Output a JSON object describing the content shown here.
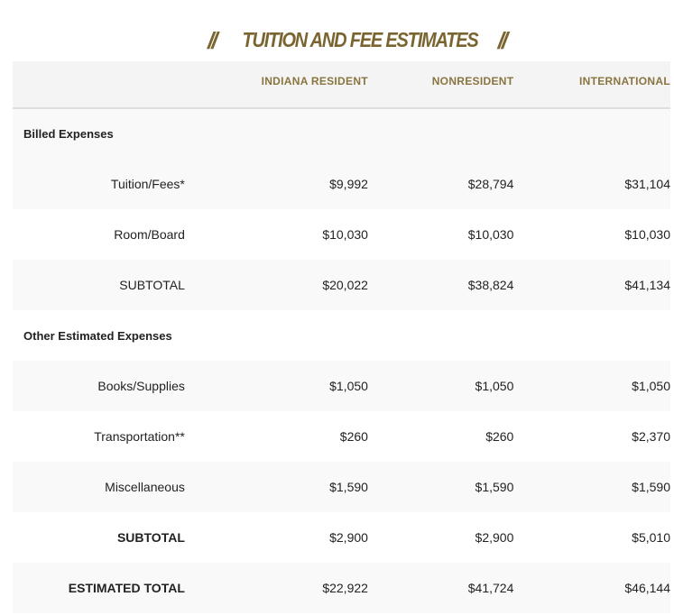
{
  "header": {
    "title": "TUITION AND FEE ESTIMATES",
    "left_slash": "//",
    "right_slash": "//"
  },
  "table": {
    "columns": [
      "",
      "INDIANA RESIDENT",
      "NONRESIDENT",
      "INTERNATIONAL"
    ],
    "sections": [
      {
        "title": "Billed Expenses",
        "rows": [
          {
            "label": "Tuition/Fees*",
            "values": [
              "$9,992",
              "$28,794",
              "$31,104"
            ],
            "bold": false
          },
          {
            "label": "Room/Board",
            "values": [
              "$10,030",
              "$10,030",
              "$10,030"
            ],
            "bold": false
          },
          {
            "label": "SUBTOTAL",
            "values": [
              "$20,022",
              "$38,824",
              "$41,134"
            ],
            "bold": false
          }
        ]
      },
      {
        "title": "Other Estimated Expenses",
        "rows": [
          {
            "label": "Books/Supplies",
            "values": [
              "$1,050",
              "$1,050",
              "$1,050"
            ],
            "bold": false
          },
          {
            "label": "Transportation**",
            "values": [
              "$260",
              "$260",
              "$2,370"
            ],
            "bold": false
          },
          {
            "label": "Miscellaneous",
            "values": [
              "$1,590",
              "$1,590",
              "$1,590"
            ],
            "bold": false
          },
          {
            "label": "SUBTOTAL",
            "values": [
              "$2,900",
              "$2,900",
              "$5,010"
            ],
            "bold": true
          }
        ]
      }
    ],
    "total": {
      "label": "ESTIMATED TOTAL",
      "values": [
        "$22,922",
        "$41,724",
        "$46,144"
      ]
    }
  },
  "colors": {
    "accent": "#7a6430",
    "header_text": "#8a7440"
  }
}
